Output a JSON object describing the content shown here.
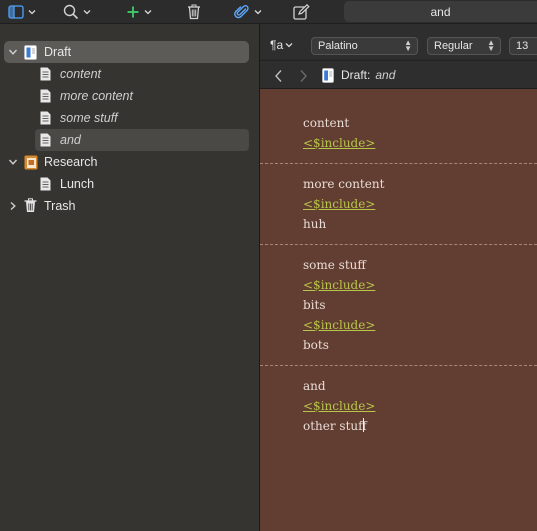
{
  "toolbar": {
    "document_title": "and",
    "icons": [
      "sidebar-toggle-icon",
      "search-icon",
      "add-icon",
      "trash-icon",
      "paperclip-icon",
      "compose-icon"
    ],
    "add_color": "#3fd06b"
  },
  "binder": {
    "items": [
      {
        "label": "Draft",
        "level": 0,
        "icon": "draft-folder-icon",
        "expanded": true,
        "selected": true
      },
      {
        "label": "content",
        "level": 1,
        "icon": "document-icon",
        "italic": true
      },
      {
        "label": "more content",
        "level": 1,
        "icon": "document-icon",
        "italic": true
      },
      {
        "label": "some stuff",
        "level": 1,
        "icon": "document-icon",
        "italic": true
      },
      {
        "label": "and",
        "level": 1,
        "icon": "document-icon",
        "italic": true,
        "selected": true
      },
      {
        "label": "Research",
        "level": 0,
        "icon": "research-folder-icon",
        "expanded": true
      },
      {
        "label": "Lunch",
        "level": 1,
        "icon": "document-icon"
      },
      {
        "label": "Trash",
        "level": 0,
        "icon": "trash-icon",
        "expanded": false
      }
    ]
  },
  "format_bar": {
    "paragraph_symbol": "¶a",
    "font": "Palatino",
    "style": "Regular",
    "size": "13"
  },
  "nav": {
    "crumb_parent": "Draft:",
    "crumb_doc": "and"
  },
  "editor": {
    "sections": [
      {
        "lines": [
          {
            "text": "content",
            "type": "text"
          },
          {
            "text": "<$include>",
            "type": "include"
          }
        ]
      },
      {
        "lines": [
          {
            "text": "more content",
            "type": "text"
          },
          {
            "text": "<$include>",
            "type": "include"
          },
          {
            "text": "huh",
            "type": "text"
          }
        ]
      },
      {
        "lines": [
          {
            "text": "some stuff",
            "type": "text"
          },
          {
            "text": "<$include>",
            "type": "include"
          },
          {
            "text": "bits",
            "type": "text"
          },
          {
            "text": "<$include>",
            "type": "include"
          },
          {
            "text": "bots",
            "type": "text"
          }
        ]
      },
      {
        "lines": [
          {
            "text": "and",
            "type": "text"
          },
          {
            "text": "<$include>",
            "type": "include"
          },
          {
            "text": "other stuff",
            "type": "text"
          }
        ]
      }
    ],
    "include_color": "#b7c64a",
    "page_color": "#623d31"
  }
}
